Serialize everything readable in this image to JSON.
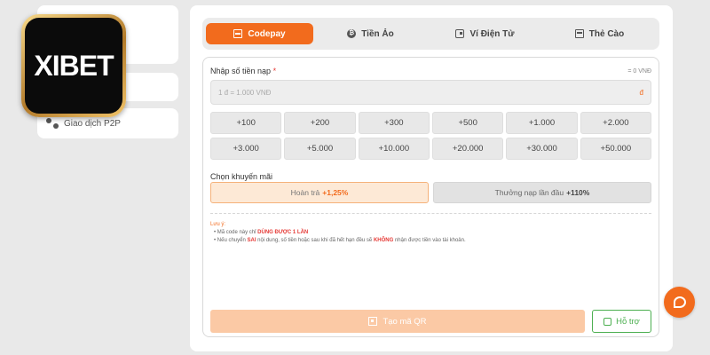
{
  "logo": {
    "text": "XIBET"
  },
  "sidebar": {
    "p2p_label": "Giao dịch P2P"
  },
  "tabs": [
    {
      "label": "Codepay",
      "icon": "codepay-icon",
      "active": true
    },
    {
      "label": "Tiền Ảo",
      "icon": "coin-icon",
      "active": false
    },
    {
      "label": "Ví Điện Tử",
      "icon": "wallet-icon",
      "active": false
    },
    {
      "label": "Thẻ Cào",
      "icon": "card-icon",
      "active": false
    }
  ],
  "form": {
    "amount_label": "Nhập số tiền nạp",
    "required_mark": "*",
    "balance": "= 0 VNĐ",
    "placeholder": "1 đ = 1.000 VNĐ",
    "currency_symbol": "đ",
    "amount_options": [
      "+100",
      "+200",
      "+300",
      "+500",
      "+1.000",
      "+2.000",
      "+3.000",
      "+5.000",
      "+10.000",
      "+20.000",
      "+30.000",
      "+50.000"
    ],
    "promo_label": "Chọn khuyến mãi",
    "promos": [
      {
        "text": "Hoàn trả",
        "value": "+1,25%",
        "selected": true
      },
      {
        "text": "Thưởng nạp lần đầu",
        "value": "+110%",
        "selected": false
      }
    ],
    "notes": {
      "title": "Lưu ý:",
      "line1_pre": "Mã code này chỉ",
      "line1_hl": "DÙNG ĐƯỢC 1 LẦN",
      "line2_pre": "Nếu chuyển",
      "line2_hl1": "SAI",
      "line2_mid": "nội dung, số tiền hoặc sau khi đã hết hạn đều sẽ",
      "line2_hl2": "KHÔNG",
      "line2_post": "nhận được tiền vào tài khoản."
    },
    "qr_button": "Tạo mã QR",
    "help_button": "Hỗ trợ"
  },
  "colors": {
    "accent": "#f26b1d",
    "help": "#4caf50",
    "highlight": "#e53935"
  }
}
